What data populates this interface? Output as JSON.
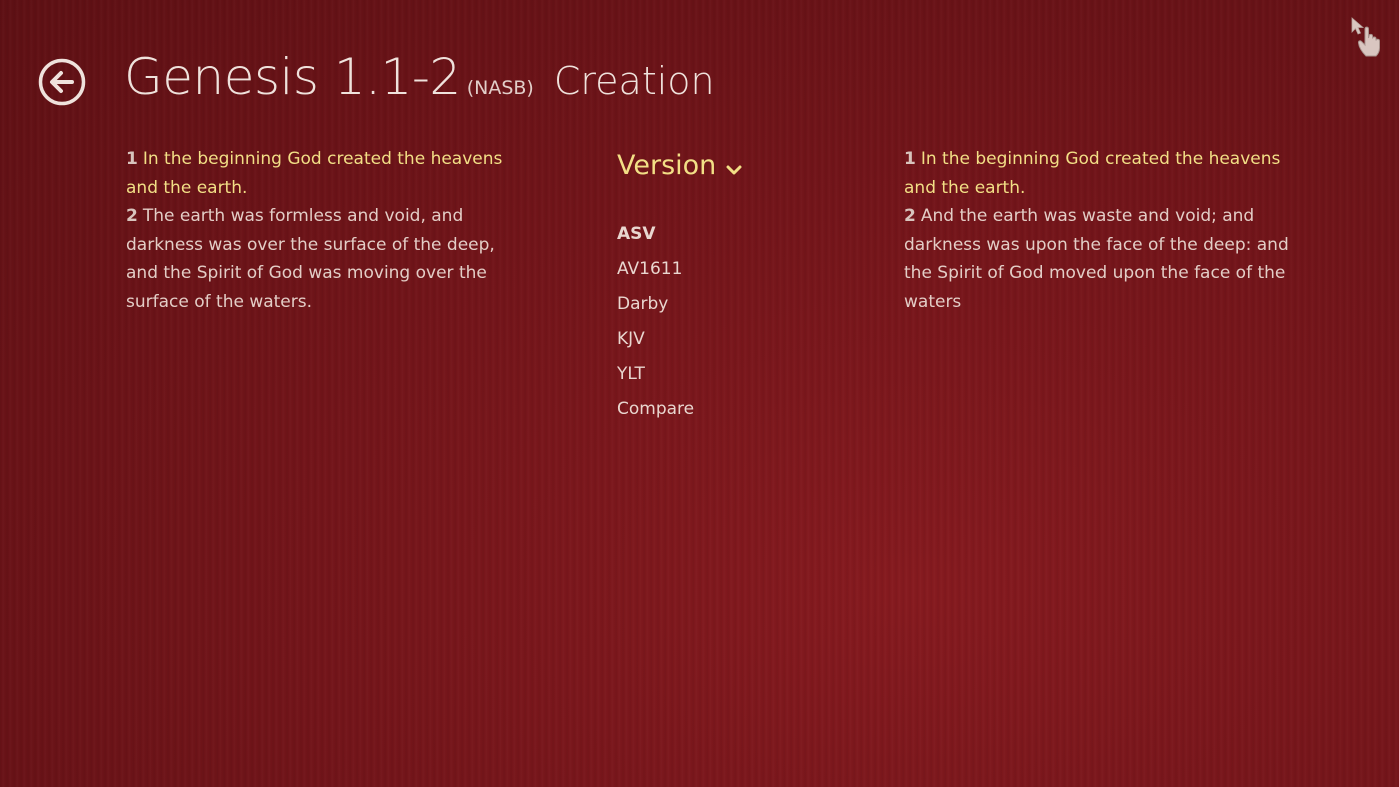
{
  "header": {
    "reference": "Genesis 1.1-2",
    "version_abbrev": "(NASB)",
    "section_title": "Creation",
    "back_icon": "back-arrow-circle-icon"
  },
  "left_passage": {
    "verses": [
      {
        "number": "1",
        "text": "In the beginning God created the heavens and the earth.",
        "highlighted": true
      },
      {
        "number": "2",
        "text": "The earth was formless and void, and darkness was over the surface of the deep, and the Spirit of God was moving over the surface of the waters.",
        "highlighted": false
      }
    ]
  },
  "version_menu": {
    "label": "Version",
    "icon": "chevron-down-icon",
    "items": [
      "ASV",
      "AV1611",
      "Darby",
      "KJV",
      "YLT",
      "Compare"
    ],
    "selected": "ASV"
  },
  "right_passage": {
    "verses": [
      {
        "number": "1",
        "text": "In the beginning God created the heavens and the earth.",
        "highlighted": true
      },
      {
        "number": "2",
        "text": "And the earth was waste and void; and darkness was upon the face of the deep: and the Spirit of God moved upon the face of the waters",
        "highlighted": false
      }
    ]
  },
  "colors": {
    "background": "#6b1418",
    "highlight": "#f2df86",
    "text": "#e3cdc6"
  },
  "corner_icon": "hand-pointer-icon"
}
